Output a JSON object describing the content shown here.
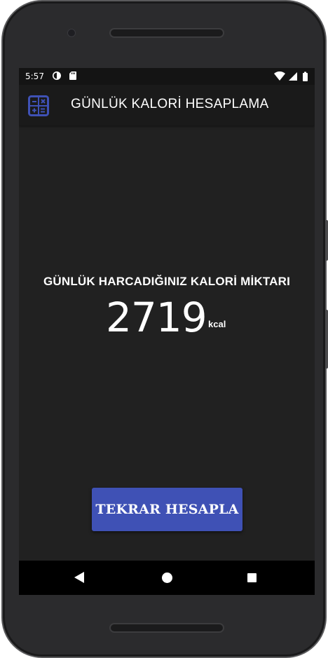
{
  "status_bar": {
    "time": "5:57",
    "left_icons": [
      "data-saver-icon",
      "sd-card-icon"
    ],
    "right_icons": [
      "wifi-icon",
      "signal-icon",
      "battery-icon"
    ]
  },
  "app_bar": {
    "icon": "calculator-icon",
    "title": "GÜNLÜK KALORİ HESAPLAMA"
  },
  "result": {
    "label": "GÜNLÜK HARCADIĞINIZ KALORİ MİKTARI",
    "value": "2719",
    "unit": "kcal"
  },
  "actions": {
    "recalculate_label": "TEKRAR HESAPLA"
  },
  "nav_bar": {
    "icons": [
      "back-icon",
      "home-icon",
      "recents-icon"
    ]
  },
  "colors": {
    "accent": "#3f51b5",
    "background": "#212121",
    "app_bar": "#1a1a1a",
    "status_bar": "#141414",
    "text": "#ffffff"
  }
}
